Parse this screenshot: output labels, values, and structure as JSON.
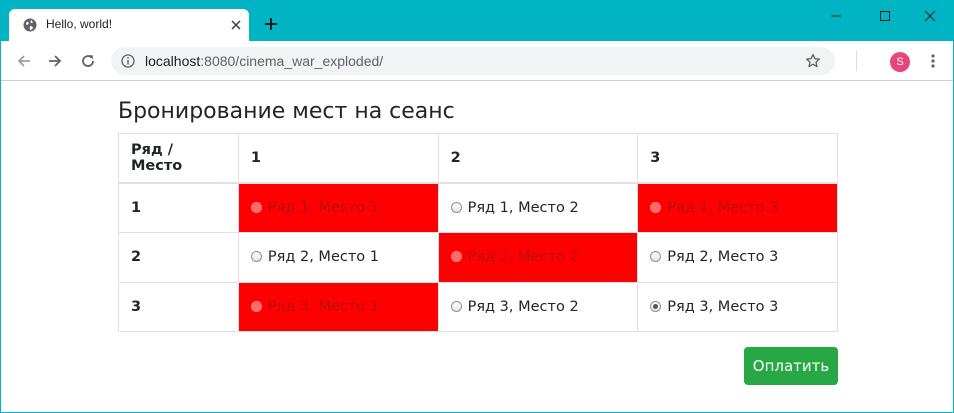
{
  "browser": {
    "tab_title": "Hello, world!",
    "url_host": "localhost",
    "url_rest": ":8080/cinema_war_exploded/",
    "profile_initial": "S",
    "accent_color": "#00b4c4"
  },
  "page": {
    "heading": "Бронирование мест на сеанс",
    "table": {
      "header": [
        "Ряд / Место",
        "1",
        "2",
        "3"
      ],
      "rows": [
        {
          "label": "1",
          "seats": [
            {
              "text": "Ряд 1, Место 1",
              "occupied": true,
              "selected": false
            },
            {
              "text": "Ряд 1, Место 2",
              "occupied": false,
              "selected": false
            },
            {
              "text": "Ряд 1, Место 3",
              "occupied": true,
              "selected": false
            }
          ]
        },
        {
          "label": "2",
          "seats": [
            {
              "text": "Ряд 2, Место 1",
              "occupied": false,
              "selected": false
            },
            {
              "text": "Ряд 2, Место 2",
              "occupied": true,
              "selected": false
            },
            {
              "text": "Ряд 2, Место 3",
              "occupied": false,
              "selected": false
            }
          ]
        },
        {
          "label": "3",
          "seats": [
            {
              "text": "Ряд 3, Место 1",
              "occupied": true,
              "selected": false
            },
            {
              "text": "Ряд 3, Место 2",
              "occupied": false,
              "selected": false
            },
            {
              "text": "Ряд 3, Место 3",
              "occupied": false,
              "selected": true
            }
          ]
        }
      ]
    },
    "pay_button_label": "Оплатить",
    "occupied_color": "#ff0000",
    "button_color": "#28a745"
  }
}
